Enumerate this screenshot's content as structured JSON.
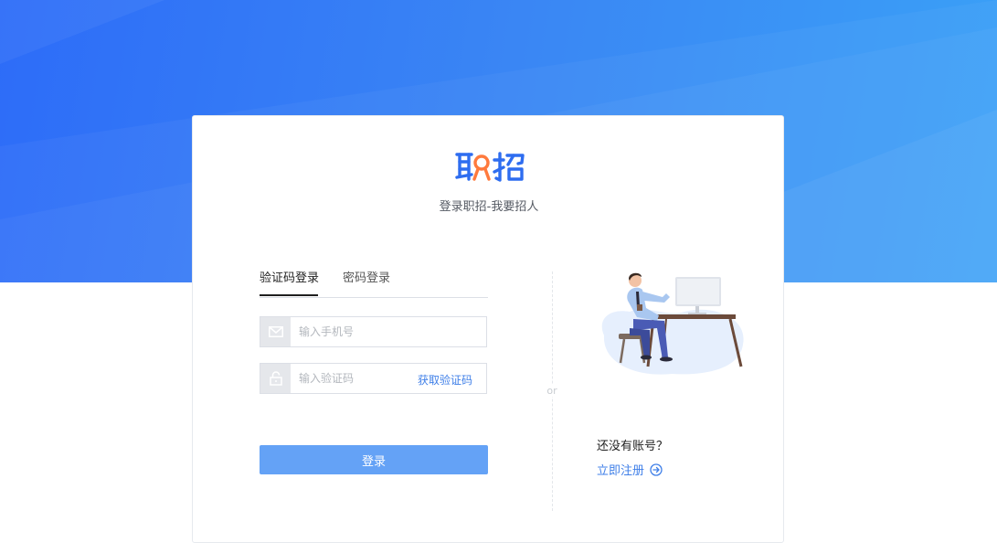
{
  "brand": {
    "logo_text": "职招",
    "subtitle": "登录职招-我要招人"
  },
  "colors": {
    "primary": "#3f7fe8",
    "button": "#64a2f6",
    "logo_blue": "#2e6df0",
    "logo_orange": "#ff7a3d",
    "hero_start": "#2d6cf8",
    "hero_end": "#3aa1f7"
  },
  "login": {
    "tabs": [
      {
        "label": "验证码登录",
        "active": true
      },
      {
        "label": "密码登录",
        "active": false
      }
    ],
    "phone": {
      "placeholder": "输入手机号",
      "value": "",
      "icon": "mail-icon"
    },
    "code": {
      "placeholder": "输入验证码",
      "value": "",
      "icon": "lock-icon"
    },
    "get_code_label": "获取验证码",
    "submit_label": "登录"
  },
  "divider_label": "or",
  "register": {
    "question": "还没有账号？",
    "link_label": "立即注册",
    "icon": "arrow-circle-right-icon"
  }
}
